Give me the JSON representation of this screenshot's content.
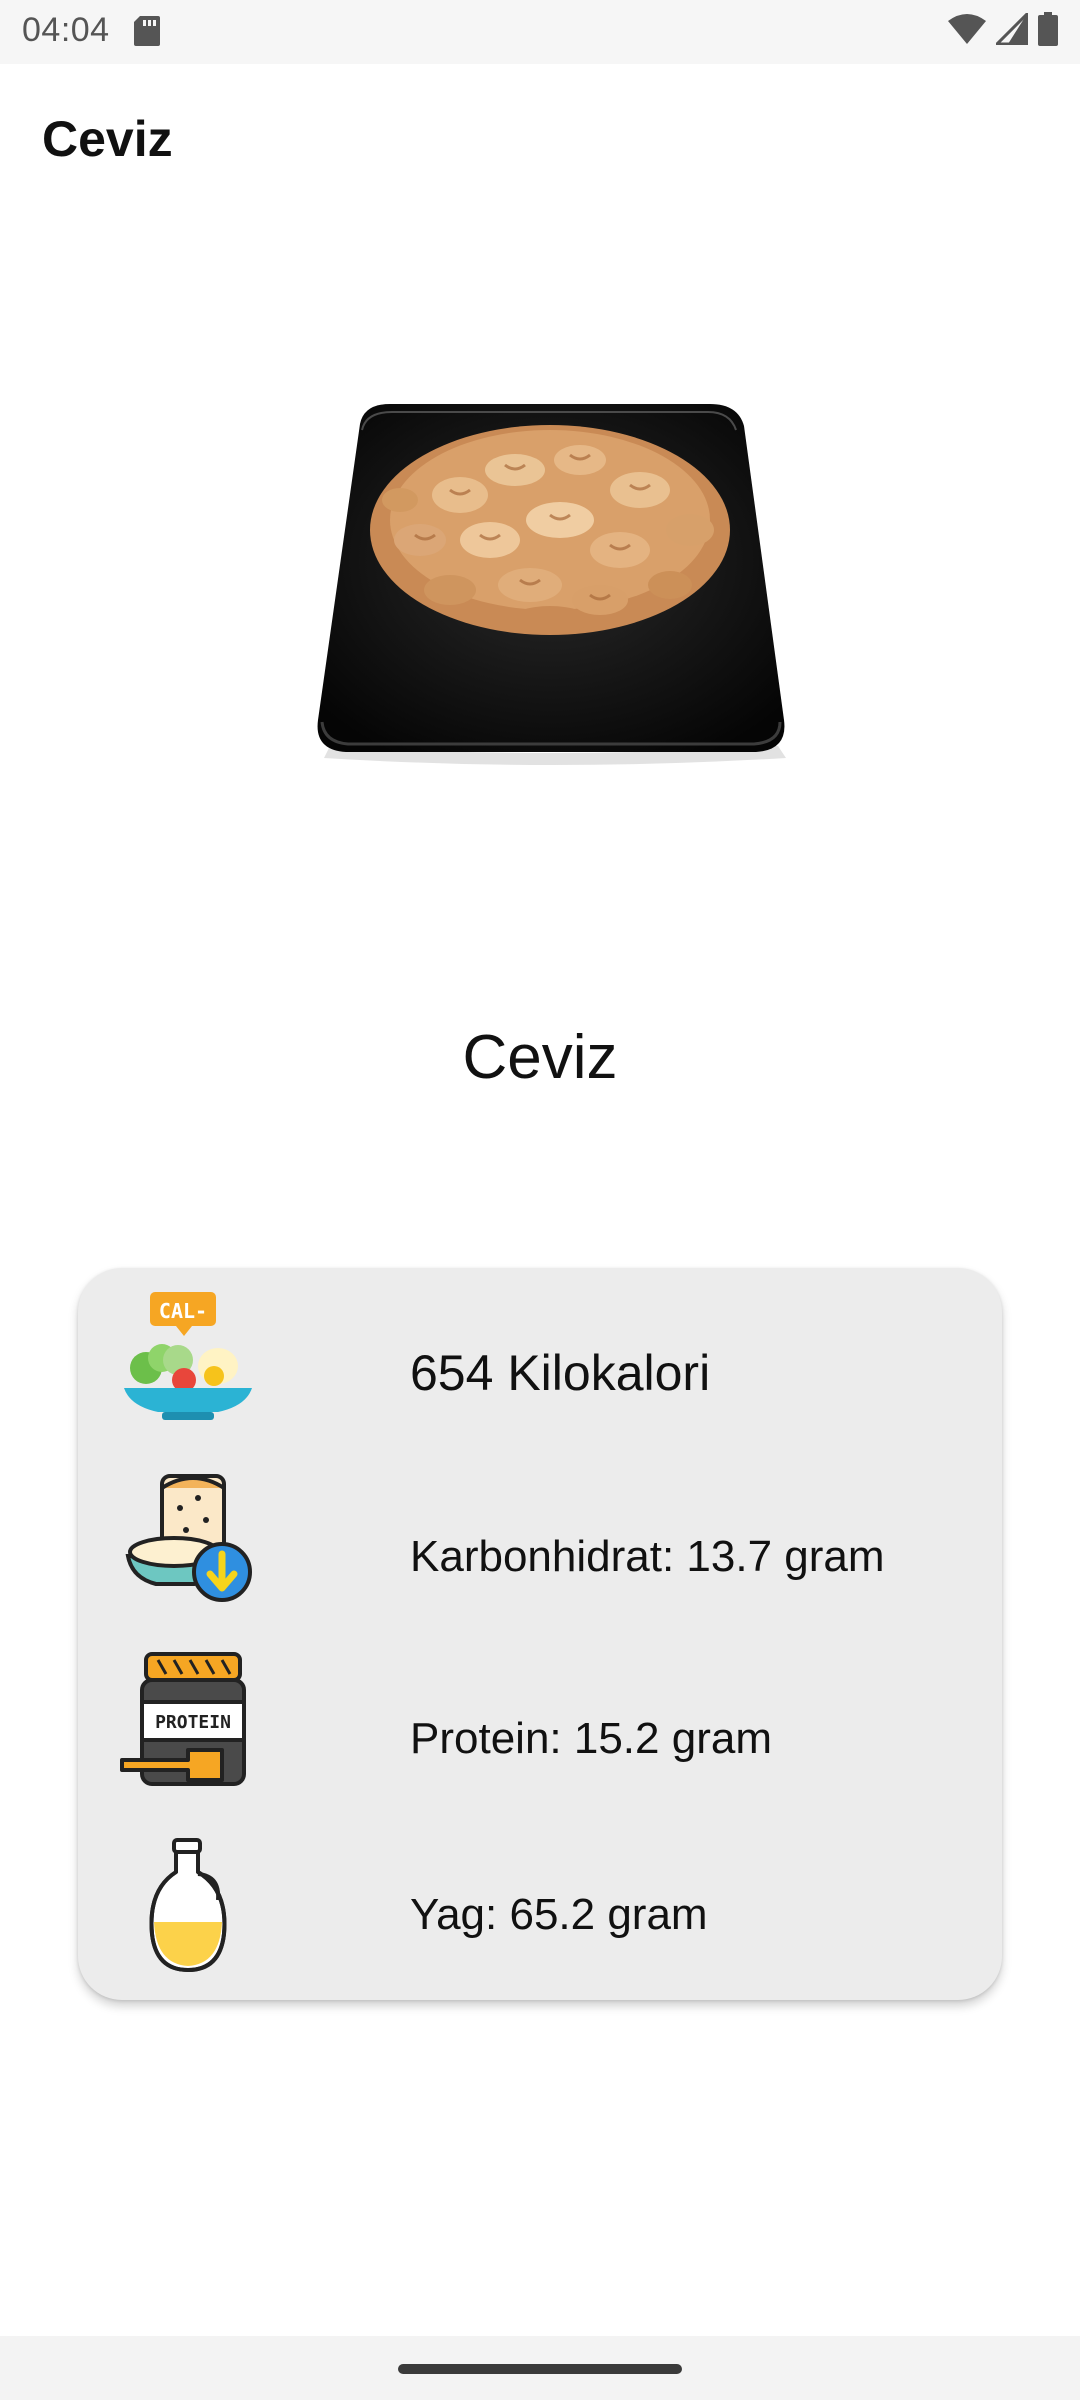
{
  "status_bar": {
    "time": "04:04",
    "icons": [
      "sd-card-icon",
      "wifi-icon",
      "signal-icon",
      "battery-icon"
    ]
  },
  "app_bar": {
    "title": "Ceviz"
  },
  "food": {
    "image_icon": "walnut-plate-image",
    "name": "Ceviz"
  },
  "nutrition": {
    "items": [
      {
        "icon": "calorie-salad-icon",
        "label": "654 Kilokalori"
      },
      {
        "icon": "carbohydrate-bread-icon",
        "label": "Karbonhidrat: 13.7 gram"
      },
      {
        "icon": "protein-jar-icon",
        "label": "Protein: 15.2 gram"
      },
      {
        "icon": "oil-bottle-icon",
        "label": "Yag: 65.2 gram"
      }
    ]
  },
  "colors": {
    "card_background": "#ececec",
    "status_bar": "#f6f6f6",
    "accent_orange": "#f6a623"
  }
}
